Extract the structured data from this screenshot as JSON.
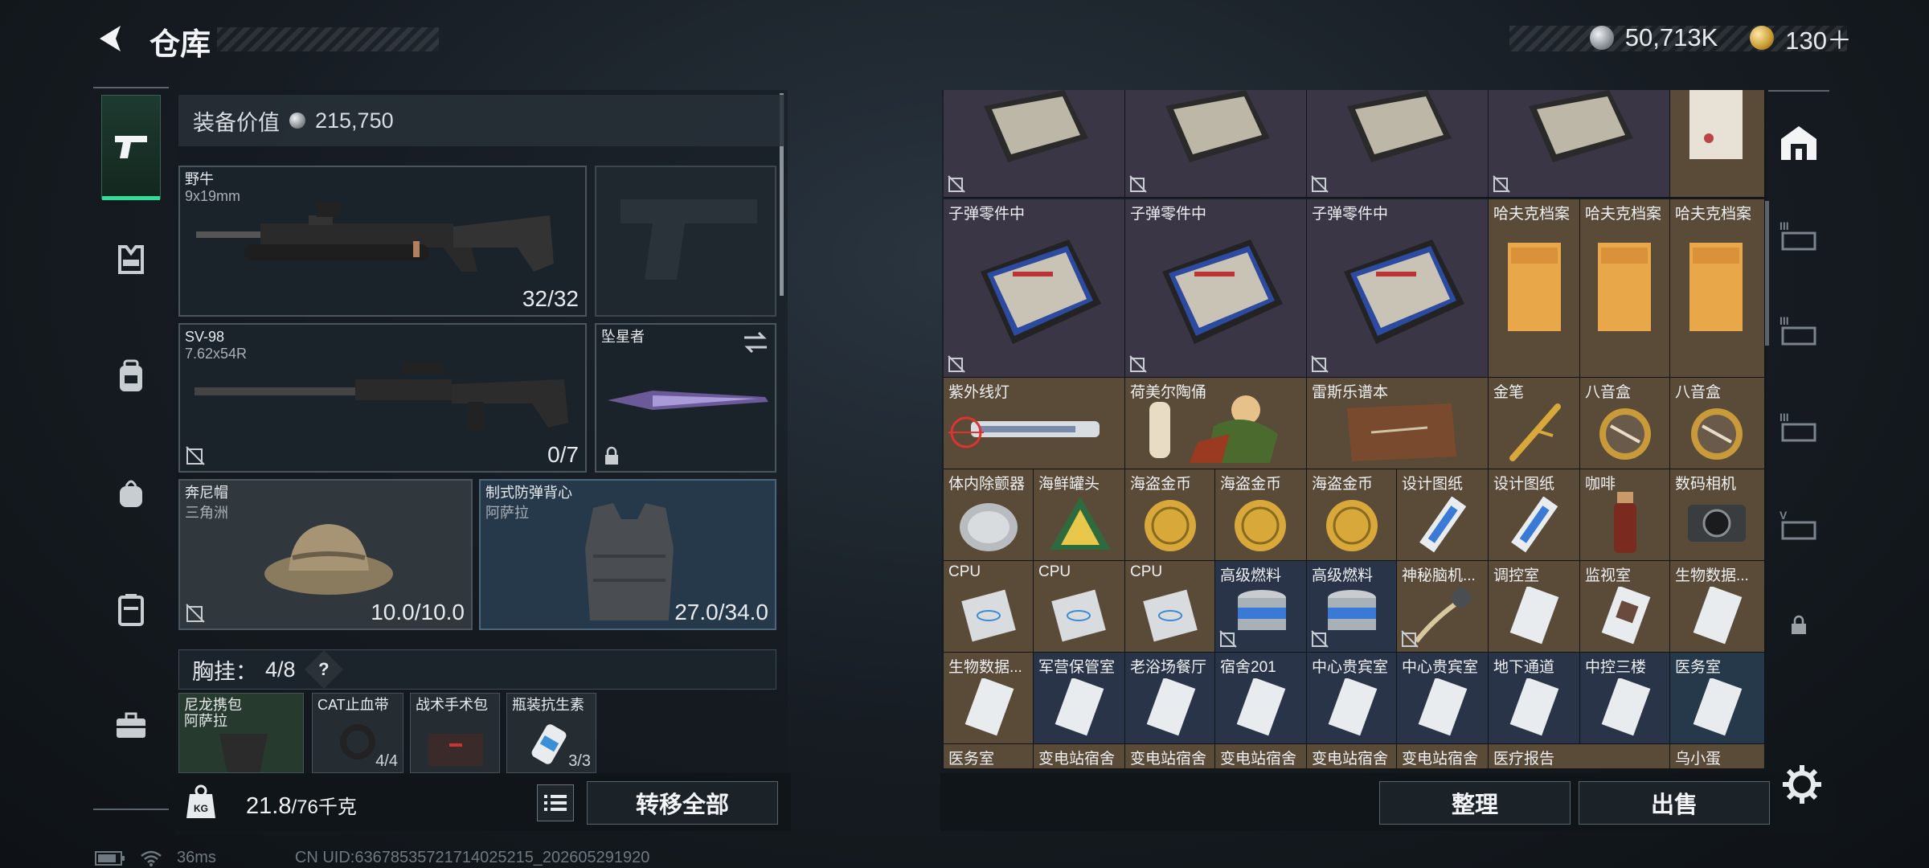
{
  "header": {
    "title": "仓库",
    "currency_primary": "50,713K",
    "currency_secondary": "130＋"
  },
  "equip": {
    "value_label": "装备价值",
    "value": "215,750",
    "primary_weapon": {
      "name": "野牛",
      "caliber": "9x19mm",
      "ammo": "32/32"
    },
    "secondary_weapon": {
      "name": "SV-98",
      "caliber": "7.62x54R",
      "ammo": "0/7"
    },
    "melee": {
      "name": "坠星者"
    },
    "helmet": {
      "name": "奔尼帽",
      "sub": "三角洲",
      "durability": "10.0/10.0"
    },
    "armor": {
      "name": "制式防弹背心",
      "sub": "阿萨拉",
      "durability": "27.0/34.0"
    },
    "chest": {
      "label": "胸挂：",
      "count": "4/8",
      "help": "?"
    },
    "chest_items": [
      {
        "name": "尼龙携包",
        "sub": "阿萨拉"
      },
      {
        "name": "CAT止血带",
        "count": "4/4"
      },
      {
        "name": "战术手术包",
        "count": ""
      },
      {
        "name": "瓶装抗生素",
        "count": "3/3"
      }
    ]
  },
  "bottom": {
    "weight": "21.8",
    "weight_max": "/76千克",
    "kg_label": "KG",
    "transfer_all": "转移全部",
    "sort": "整理",
    "sell": "出售"
  },
  "status": {
    "ping": "36ms",
    "uid": "CN UID:6367853572171402521​5_202605291920"
  },
  "grid": {
    "row0": [
      "",
      "",
      "",
      "",
      ""
    ],
    "row1": [
      "子弹零件中",
      "子弹零件中",
      "子弹零件中",
      "哈夫克档案",
      "哈夫克档案",
      "哈夫克档案"
    ],
    "row2": [
      "紫外线灯",
      "荷美尔陶俑",
      "雷斯乐谱本",
      "金笔",
      "八音盒",
      "八音盒"
    ],
    "row3": [
      "体内除颤器",
      "海鲜罐头",
      "海盗金币",
      "海盗金币",
      "海盗金币",
      "设计图纸",
      "设计图纸",
      "咖啡",
      "数码相机"
    ],
    "row4": [
      "CPU",
      "CPU",
      "CPU",
      "高级燃料",
      "高级燃料",
      "神秘脑机...",
      "调控室",
      "监视室",
      "生物数据..."
    ],
    "row5": [
      "生物数据...",
      "军营保管室",
      "老浴场餐厅",
      "宿舍201",
      "中心贵宾室",
      "中心贵宾室",
      "地下通道",
      "中控三楼",
      "医务室"
    ],
    "row6": [
      "医务室",
      "变电站宿舍",
      "变电站宿舍",
      "变电站宿舍",
      "变电站宿舍",
      "变电站宿舍",
      "医疗报告",
      "",
      "乌小蛋"
    ]
  }
}
